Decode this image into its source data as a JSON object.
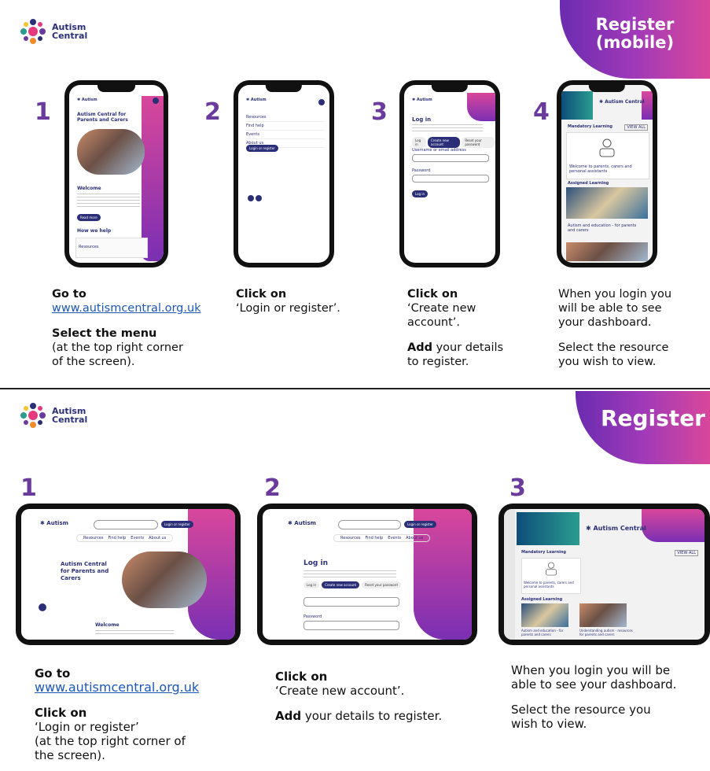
{
  "brand": {
    "line1": "Autism",
    "line2": "Central"
  },
  "mobile_section": {
    "banner_line1": "Register",
    "banner_line2": "(mobile)",
    "steps": [
      {
        "number": "1",
        "phone": {
          "title_line1": "Autism Central for",
          "title_line2": "Parents and Carers",
          "welcome": "Welcome",
          "read_more": "Read more",
          "how_we_help": "How we help",
          "resources": "Resources"
        },
        "cap_bold_1": "Go to",
        "cap_link": "www.autismcentral.org.uk",
        "cap_bold_2": "Select the menu",
        "cap_text_2a": "(at the top right corner",
        "cap_text_2b": "of the screen)."
      },
      {
        "number": "2",
        "phone": {
          "menu": [
            "Resources",
            "Find help",
            "Events",
            "About us"
          ],
          "login_button": "Login or register"
        },
        "cap_bold_1": "Click on",
        "cap_text_1": "‘Login or register’."
      },
      {
        "number": "3",
        "phone": {
          "heading": "Log in",
          "tabs": [
            "Log in",
            "Create new account",
            "Reset your password"
          ],
          "username_label": "Username or email address",
          "password_label": "Password",
          "submit": "Log in"
        },
        "cap_bold_1": "Click on",
        "cap_text_1a": "‘Create new",
        "cap_text_1b": "account’.",
        "cap_bold_2": "Add",
        "cap_text_2a": " your details",
        "cap_text_2b": "to register."
      },
      {
        "number": "4",
        "phone": {
          "section1": "Mandatory Learning",
          "view_all": "VIEW ALL",
          "card1": "Welcome to parents, carers and personal assistants",
          "section2": "Assigned Learning",
          "card2": "Autism and education - for parents and carers"
        },
        "cap_text_1": "When you login you",
        "cap_text_2": "will be able to see",
        "cap_text_3": "your dashboard.",
        "cap_text_4": "Select the resource",
        "cap_text_5": "you wish to view."
      }
    ]
  },
  "desktop_section": {
    "banner": "Register",
    "steps": [
      {
        "number": "1",
        "tablet": {
          "login_button": "Login or register",
          "nav": [
            "Resources",
            "Find help",
            "Events",
            "About us"
          ],
          "title_line1": "Autism Central",
          "title_line2": "for Parents and",
          "title_line3": "Carers",
          "welcome": "Welcome"
        },
        "cap_bold_1": "Go to",
        "cap_link": "www.autismcentral.org.uk",
        "cap_bold_2": "Click on",
        "cap_text_2a": "‘Login or register’",
        "cap_text_2b": "(at the top right corner of",
        "cap_text_2c": "the screen)."
      },
      {
        "number": "2",
        "tablet": {
          "login_button": "Login or register",
          "nav": [
            "Resources",
            "Find help",
            "Events",
            "About us"
          ],
          "heading": "Log in",
          "tabs": [
            "Log in",
            "Create new account",
            "Reset your password"
          ],
          "password_label": "Password"
        },
        "cap_bold_1": "Click on",
        "cap_text_1": "‘Create new account’.",
        "cap_bold_2": "Add",
        "cap_text_2": " your details to register."
      },
      {
        "number": "3",
        "tablet": {
          "section1": "Mandatory Learning",
          "section2": "Assigned Learning",
          "view_all": "VIEW ALL",
          "card1": "Welcome to parents, carers and personal assistants",
          "card2": "Autism and education - for parents and carers",
          "card3": "Understanding autism - resources for parents and carers"
        },
        "cap_text_1": "When you login you will be",
        "cap_text_2": "able to see your dashboard.",
        "cap_text_3": "Select the resource you",
        "cap_text_4": "wish to view."
      }
    ]
  },
  "colors": {
    "purple": "#6a3a9c",
    "navy": "#2b2f78",
    "pink": "#d9479b",
    "link": "#1e58b7"
  }
}
